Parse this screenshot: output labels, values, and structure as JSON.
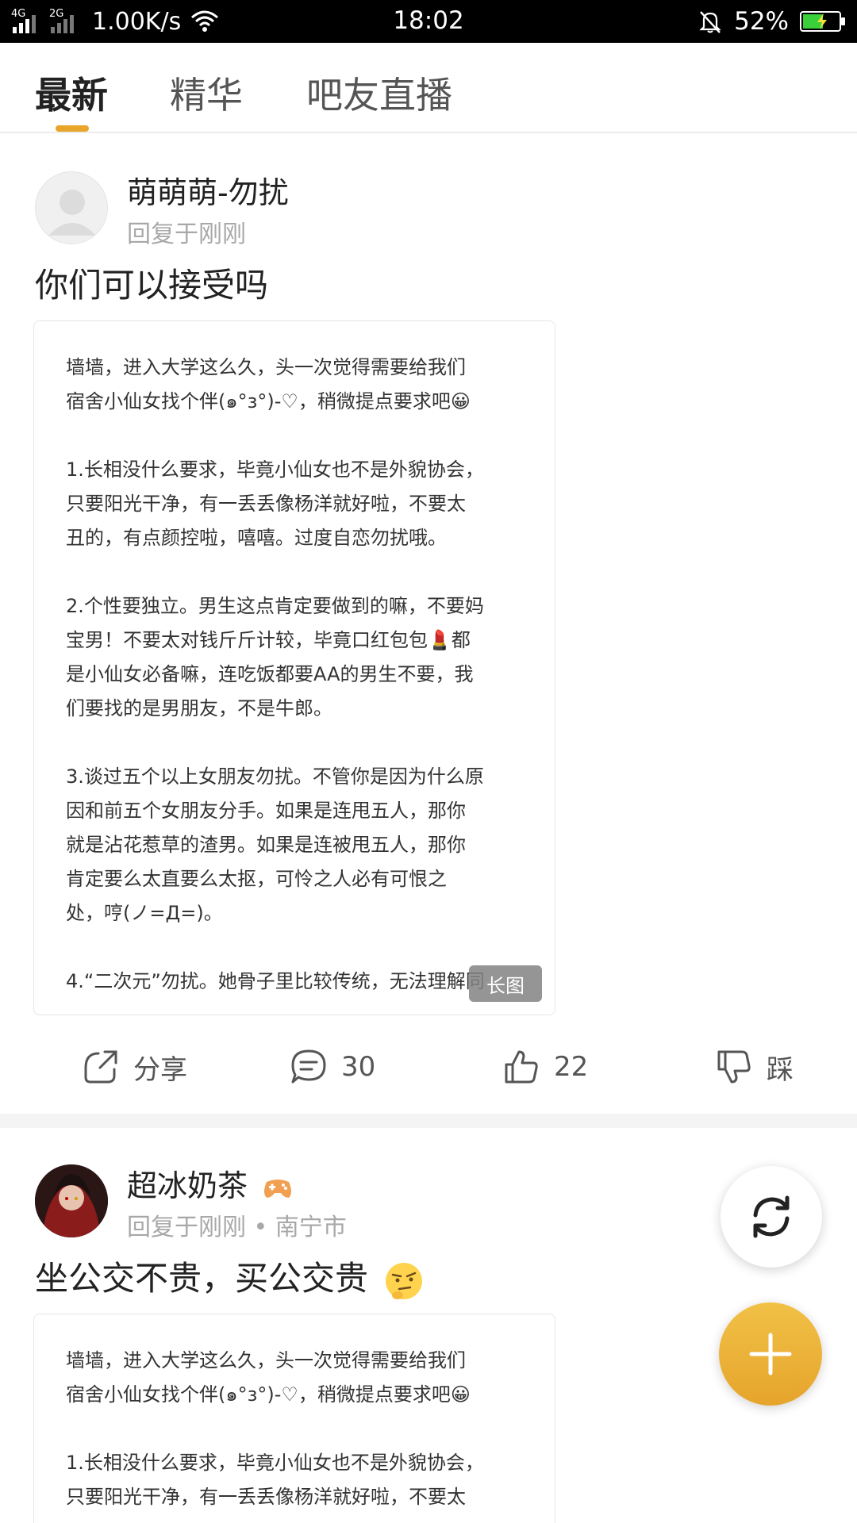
{
  "status_bar": {
    "network_1": "4G",
    "network_2": "2G",
    "speed": "1.00K/s",
    "time": "18:02",
    "battery": "52%"
  },
  "tabs": [
    {
      "label": "最新",
      "active": true
    },
    {
      "label": "精华",
      "active": false
    },
    {
      "label": "吧友直播",
      "active": false
    }
  ],
  "posts": [
    {
      "author": "萌萌萌-勿扰",
      "meta": "回复于刚刚",
      "title": "你们可以接受吗",
      "image_lines": [
        "墙墙，进入大学这么久，头一次觉得需要给我们",
        "宿舍小仙女找个伴(๑°з°)-♡，稍微提点要求吧😀",
        "",
        "1.长相没什么要求，毕竟小仙女也不是外貌协会，",
        "只要阳光干净，有一丢丢像杨洋就好啦，不要太",
        "丑的，有点颜控啦，嘻嘻。过度自恋勿扰哦。",
        "",
        "2.个性要独立。男生这点肯定要做到的嘛，不要妈",
        "宝男！不要太对钱斤斤计较，毕竟口红包包💄都",
        "是小仙女必备嘛，连吃饭都要AA的男生不要，我",
        "们要找的是男朋友，不是牛郎。",
        "",
        "3.谈过五个以上女朋友勿扰。不管你是因为什么原",
        "因和前五个女朋友分手。如果是连甩五人，那你",
        "就是沾花惹草的渣男。如果是连被甩五人，那你",
        "肯定要么太直要么太抠，可怜之人必有可恨之",
        "处，哼(ノ=Д=)。",
        "",
        "4.“二次元”勿扰。她骨子里比较传统，无法理解同"
      ],
      "long_image_badge": "长图",
      "share_label": "分享",
      "comment_count": "30",
      "like_count": "22",
      "dislike_label": "踩"
    },
    {
      "author": "超冰奶茶",
      "meta": "回复于刚刚 • 南宁市",
      "title": "坐公交不贵，买公交贵",
      "image_lines": [
        "墙墙，进入大学这么久，头一次觉得需要给我们",
        "宿舍小仙女找个伴(๑°з°)-♡，稍微提点要求吧😀",
        "",
        "1.长相没什么要求，毕竟小仙女也不是外貌协会，",
        "只要阳光干净，有一丢丢像杨洋就好啦，不要太"
      ]
    }
  ],
  "colors": {
    "accent": "#e8a52a",
    "fab_add": "#eeb33c",
    "badge": "#8a8a8a"
  },
  "icons": [
    "signal-icon",
    "wifi-icon",
    "mute-bell-icon",
    "battery-icon",
    "share-icon",
    "comment-icon",
    "like-icon",
    "dislike-icon",
    "refresh-icon",
    "add-icon",
    "gamepad-icon",
    "thinking-emoji-icon"
  ]
}
